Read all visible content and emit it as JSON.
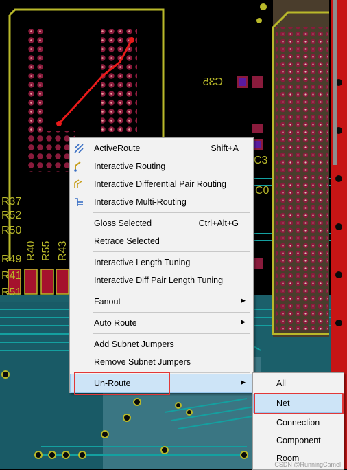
{
  "context_menu": {
    "items": [
      {
        "label": "ActiveRoute",
        "shortcut": "Shift+A",
        "icon": "active-route-icon"
      },
      {
        "label": "Interactive Routing",
        "shortcut": "",
        "icon": "interactive-routing-icon"
      },
      {
        "label": "Interactive Differential Pair Routing",
        "shortcut": "",
        "icon": "diff-pair-routing-icon"
      },
      {
        "label": "Interactive Multi-Routing",
        "shortcut": "",
        "icon": "multi-routing-icon"
      },
      {
        "label": "Gloss Selected",
        "shortcut": "Ctrl+Alt+G"
      },
      {
        "label": "Retrace Selected",
        "shortcut": ""
      },
      {
        "label": "Interactive Length Tuning",
        "shortcut": ""
      },
      {
        "label": "Interactive Diff Pair Length Tuning",
        "shortcut": ""
      },
      {
        "label": "Fanout",
        "submenu": true
      },
      {
        "label": "Auto Route",
        "submenu": true
      },
      {
        "label": "Add Subnet Jumpers",
        "shortcut": ""
      },
      {
        "label": "Remove Subnet Jumpers",
        "shortcut": ""
      },
      {
        "label": "Un-Route",
        "submenu": true,
        "highlighted": true
      }
    ]
  },
  "unroute_submenu": {
    "items": [
      {
        "label": "All"
      },
      {
        "label": "Net",
        "highlighted": true
      },
      {
        "label": "Connection"
      },
      {
        "label": "Component"
      },
      {
        "label": "Room"
      }
    ]
  },
  "pcb_labels": {
    "c35": "C35",
    "c3": "C3",
    "c0": "C0",
    "r37": "R37",
    "r52": "R52",
    "r50": "R50",
    "r49": "R49",
    "r41": "R41",
    "r51": "R51",
    "r40": "R40",
    "r55": "R55",
    "r43": "R43"
  },
  "watermark": "CSDN @RunningCamel",
  "colors": {
    "board_background": "#000000",
    "silkscreen": "#b9b92a",
    "top_copper": "#e81a1a",
    "pad": "#8a1b3c",
    "bottom_layer": "#138c8c",
    "menu_background": "#f2f2f2",
    "menu_highlight": "#cde4f7",
    "annotation_box": "#e23838"
  }
}
